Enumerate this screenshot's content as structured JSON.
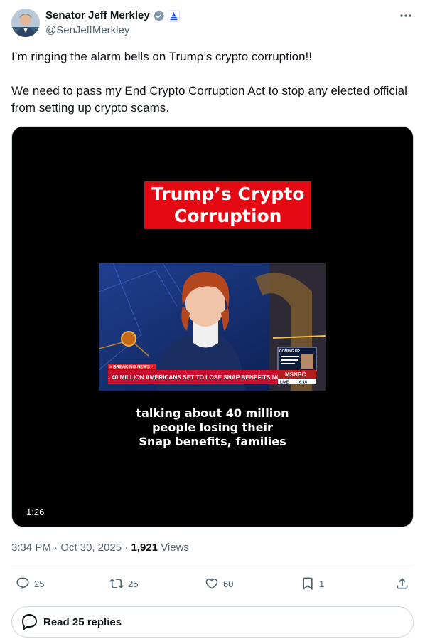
{
  "author": {
    "display_name": "Senator Jeff Merkley",
    "handle": "@SenJeffMerkley",
    "verified_badge_color": "#1d9bf0",
    "gov_badge_color": "#1d4ed8"
  },
  "tweet": {
    "paragraph1": "I’m ringing the alarm bells on Trump’s crypto corruption!!",
    "paragraph2": "We need to pass my End Crypto Corruption Act to stop any elected official from setting up crypto scams."
  },
  "video": {
    "title_line1": "Trump’s Crypto",
    "title_line2": "Corruption",
    "title_bg_color": "#e50914",
    "caption_line1": "talking about 40 million",
    "caption_line2": "people losing their",
    "caption_line3": "Snap benefits, families",
    "duration": "1:26",
    "breaking_label": "> BREAKING NEWS",
    "headline": "40 MILLION AMERICANS SET TO LOSE SNAP BENEFITS NOV. 1",
    "network": "MSNBC",
    "live_label": "LIVE",
    "live_time": "6:16",
    "coming_up": "COMING UP"
  },
  "meta": {
    "time": "3:34 PM",
    "date": "Oct 30, 2025",
    "views_count": "1,921",
    "views_label": "Views"
  },
  "actions": {
    "replies": "25",
    "reposts": "25",
    "likes": "60",
    "bookmarks": "1"
  },
  "read_replies_label": "Read 25 replies",
  "icons": [
    "verified-icon",
    "government-icon",
    "more-icon",
    "reply-icon",
    "repost-icon",
    "like-icon",
    "bookmark-icon",
    "share-icon",
    "speech-bubble-icon"
  ]
}
